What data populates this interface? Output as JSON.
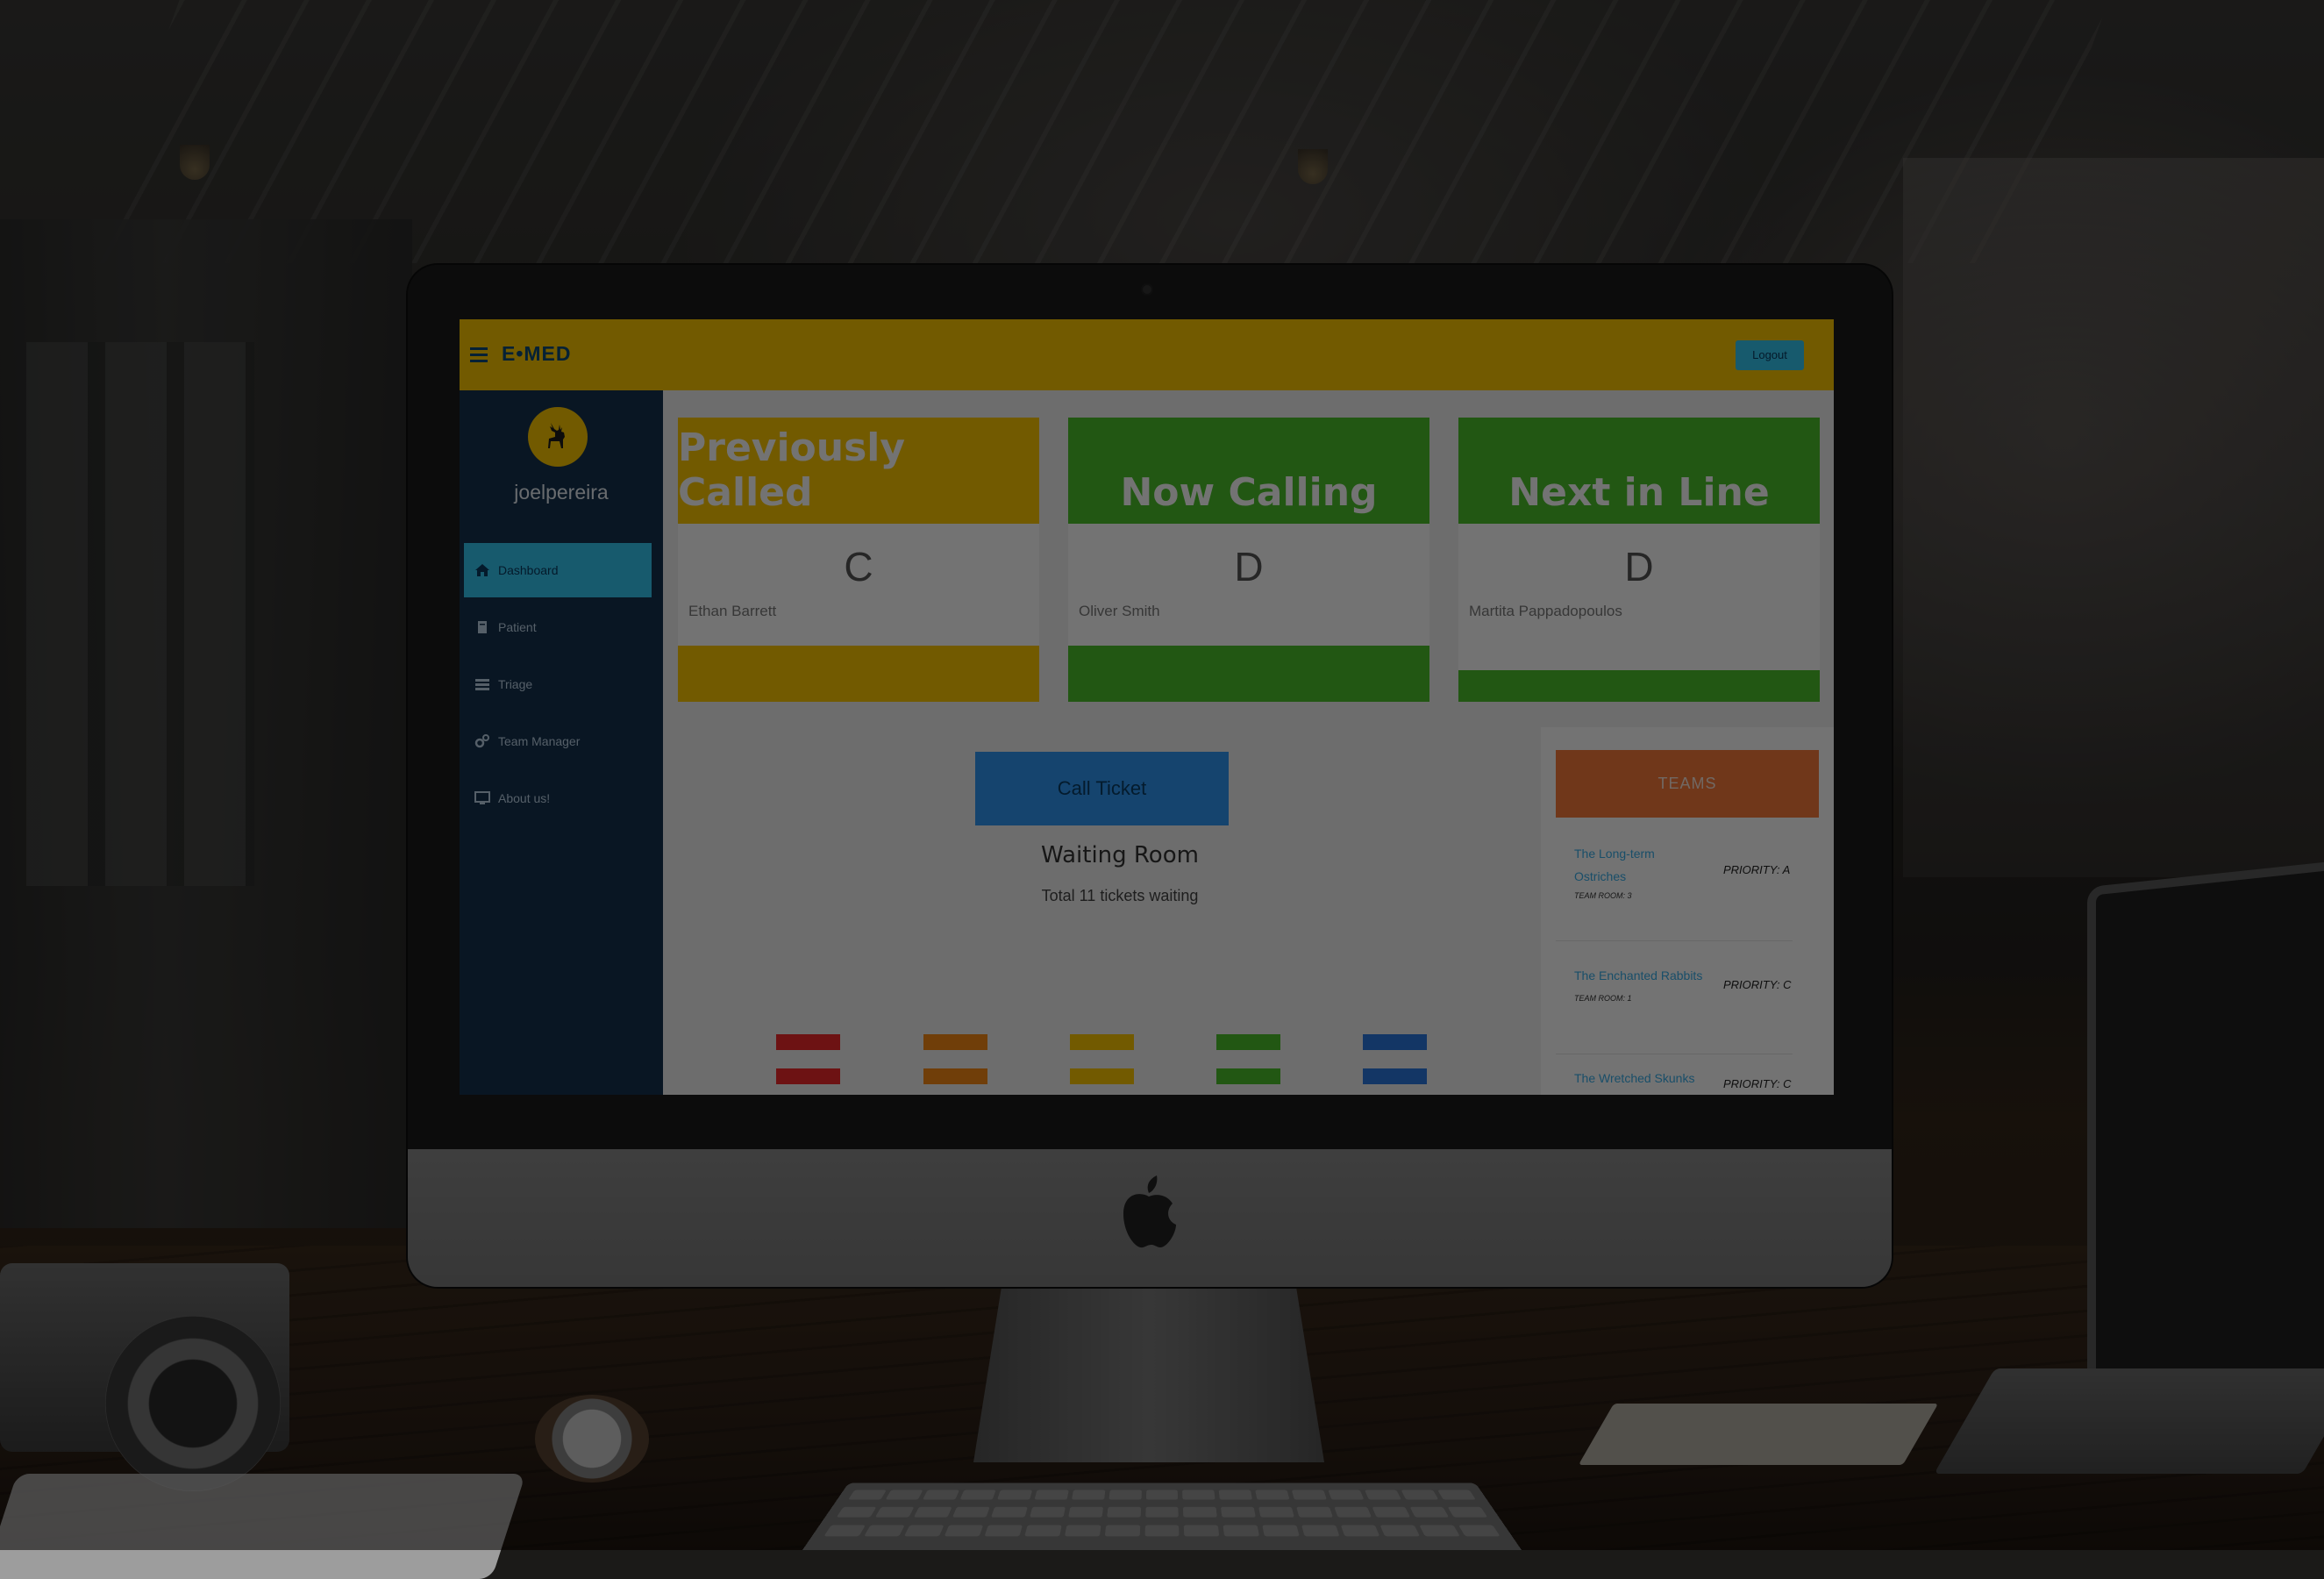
{
  "topbar": {
    "brand": "E•MED",
    "logout_label": "Logout"
  },
  "sidebar": {
    "username": "joelpereira",
    "items": [
      {
        "label": "Dashboard",
        "icon": "dashboard-icon",
        "active": true
      },
      {
        "label": "Patient",
        "icon": "book-icon"
      },
      {
        "label": "Triage",
        "icon": "list-icon"
      },
      {
        "label": "Team Manager",
        "icon": "gears-icon"
      },
      {
        "label": "About us!",
        "icon": "monitor-icon"
      }
    ]
  },
  "cards": [
    {
      "title": "Previously Called",
      "letter": "C",
      "patient": "Ethan Barrett",
      "color": "#fdc800"
    },
    {
      "title": "Now Calling",
      "letter": "D",
      "patient": "Oliver Smith",
      "color": "#4cc22c"
    },
    {
      "title": "Next in Line",
      "letter": "D",
      "patient": "Martita Pappadopoulos",
      "color": "#4cc22c"
    }
  ],
  "actions": {
    "call_ticket_label": "Call Ticket"
  },
  "waiting": {
    "title": "Waiting Room",
    "subtitle": "Total 11 tickets waiting"
  },
  "triage_colors": [
    "#f1282c",
    "#f98a16",
    "#fdc800",
    "#4cc22c",
    "#2a78e0"
  ],
  "teams": {
    "header": "TEAMS",
    "items": [
      {
        "name": "The Long-term Ostriches",
        "room": "TEAM ROOM: 3",
        "priority": "PRIORITY: A"
      },
      {
        "name": "The Enchanted Rabbits",
        "room": "TEAM ROOM: 1",
        "priority": "PRIORITY: C"
      },
      {
        "name": "The Wretched Skunks",
        "room": "",
        "priority": "PRIORITY: C"
      }
    ]
  }
}
